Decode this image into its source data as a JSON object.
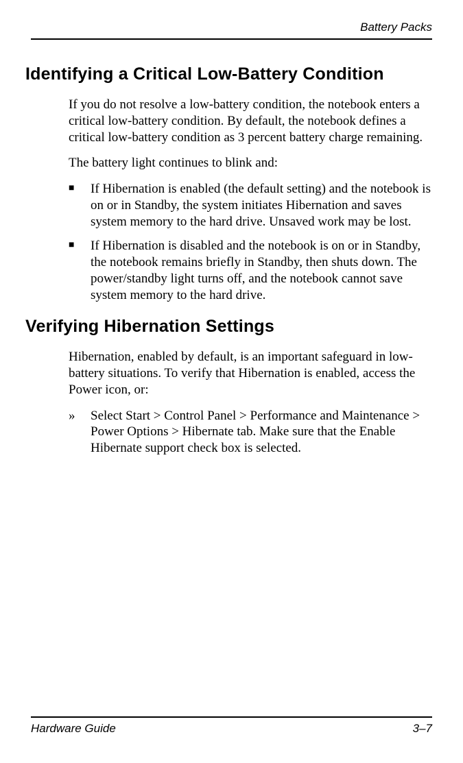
{
  "header": {
    "section": "Battery Packs"
  },
  "section1": {
    "title": "Identifying a Critical Low-Battery Condition",
    "para1": "If you do not resolve a low-battery condition, the notebook enters a critical low-battery condition. By default, the notebook defines a critical low-battery condition as 3 percent battery charge remaining.",
    "para2": "The battery light continues to blink and:",
    "bullets": [
      "If Hibernation is enabled (the default setting) and the notebook is on or in Standby, the system initiates Hibernation and saves system memory to the hard drive. Unsaved work may be lost.",
      "If Hibernation is disabled and the notebook is on or in Standby, the notebook remains briefly in Standby, then shuts down. The power/standby light turns off, and the notebook cannot save system memory to the hard drive."
    ]
  },
  "section2": {
    "title": "Verifying Hibernation Settings",
    "para1": "Hibernation, enabled by default, is an important safeguard in low-battery situations. To verify that Hibernation is enabled, access the Power icon, or:",
    "bullets": [
      "Select Start > Control Panel > Performance and Maintenance > Power Options > Hibernate tab. Make sure that the Enable Hibernate support check box is selected."
    ]
  },
  "footer": {
    "left": "Hardware Guide",
    "right": "3–7"
  }
}
